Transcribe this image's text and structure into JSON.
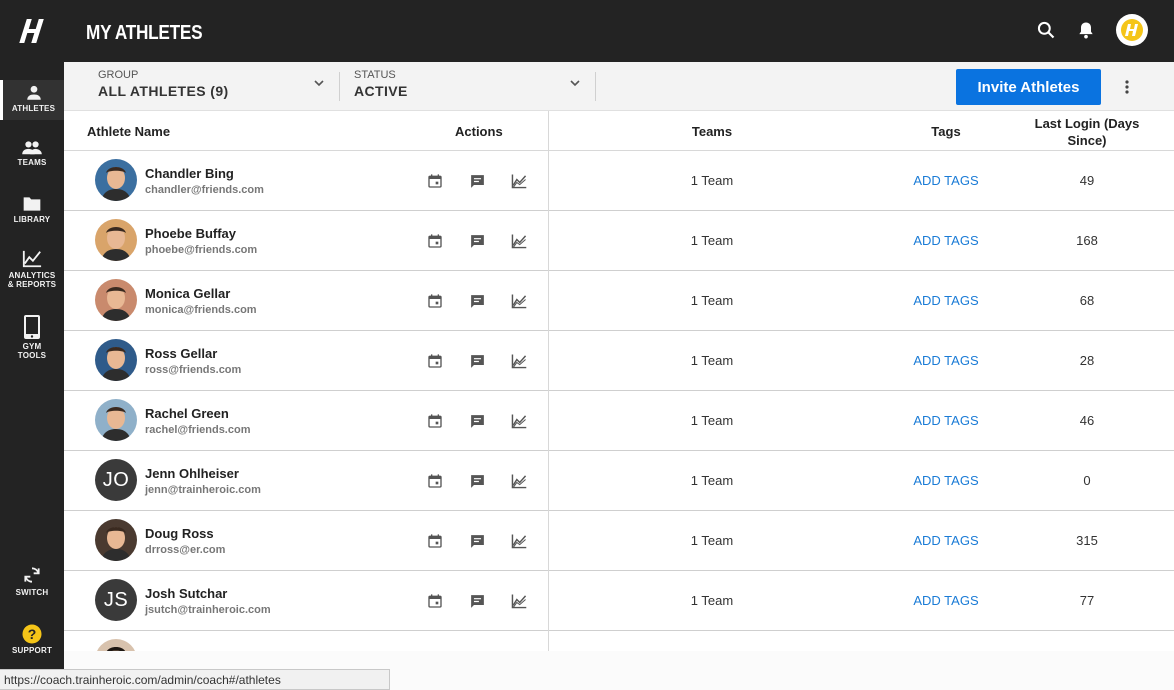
{
  "app": {
    "page_title": "MY ATHLETES"
  },
  "sidebar": {
    "items": [
      {
        "label": "ATHLETES",
        "icon": "person-icon",
        "active": true
      },
      {
        "label": "TEAMS",
        "icon": "group-icon"
      },
      {
        "label": "LIBRARY",
        "icon": "folder-icon"
      },
      {
        "label": "ANALYTICS\n& REPORTS",
        "icon": "analytics-icon"
      },
      {
        "label": "GYM\nTOOLS",
        "icon": "tablet-icon"
      }
    ],
    "bottom": [
      {
        "label": "SWITCH",
        "icon": "switch-icon"
      },
      {
        "label": "SUPPORT",
        "icon": "support-icon"
      }
    ]
  },
  "filters": {
    "group_label": "GROUP",
    "group_value": "ALL ATHLETES (9)",
    "status_label": "STATUS",
    "status_value": "ACTIVE",
    "invite_label": "Invite Athletes"
  },
  "table": {
    "headers": {
      "name": "Athlete Name",
      "actions": "Actions",
      "teams": "Teams",
      "tags": "Tags",
      "last_login": "Last Login (Days Since)"
    },
    "rows": [
      {
        "name": "Chandler Bing",
        "email": "chandler@friends.com",
        "teams": "1 Team",
        "tags": "ADD TAGS",
        "last_login": "49",
        "avatar_color": "#3b6fa0"
      },
      {
        "name": "Phoebe Buffay",
        "email": "phoebe@friends.com",
        "teams": "1 Team",
        "tags": "ADD TAGS",
        "last_login": "168",
        "avatar_color": "#d9a46a"
      },
      {
        "name": "Monica Gellar",
        "email": "monica@friends.com",
        "teams": "1 Team",
        "tags": "ADD TAGS",
        "last_login": "68",
        "avatar_color": "#c98a6d"
      },
      {
        "name": "Ross Gellar",
        "email": "ross@friends.com",
        "teams": "1 Team",
        "tags": "ADD TAGS",
        "last_login": "28",
        "avatar_color": "#2f5b8a"
      },
      {
        "name": "Rachel Green",
        "email": "rachel@friends.com",
        "teams": "1 Team",
        "tags": "ADD TAGS",
        "last_login": "46",
        "avatar_color": "#8fb0c9"
      },
      {
        "name": "Jenn Ohlheiser",
        "email": "jenn@trainheroic.com",
        "teams": "1 Team",
        "tags": "ADD TAGS",
        "last_login": "0",
        "initials": "JO"
      },
      {
        "name": "Doug Ross",
        "email": "drross@er.com",
        "teams": "1 Team",
        "tags": "ADD TAGS",
        "last_login": "315",
        "avatar_color": "#4a3a30"
      },
      {
        "name": "Josh Sutchar",
        "email": "jsutch@trainheroic.com",
        "teams": "1 Team",
        "tags": "ADD TAGS",
        "last_login": "77",
        "initials": "JS"
      }
    ]
  },
  "status_url": "https://coach.trainheroic.com/admin/coach#/athletes",
  "colors": {
    "sidebar_bg": "#232323",
    "accent_blue": "#0a73e0",
    "link_blue": "#1a7bd6",
    "brand_yellow": "#f5c518"
  }
}
